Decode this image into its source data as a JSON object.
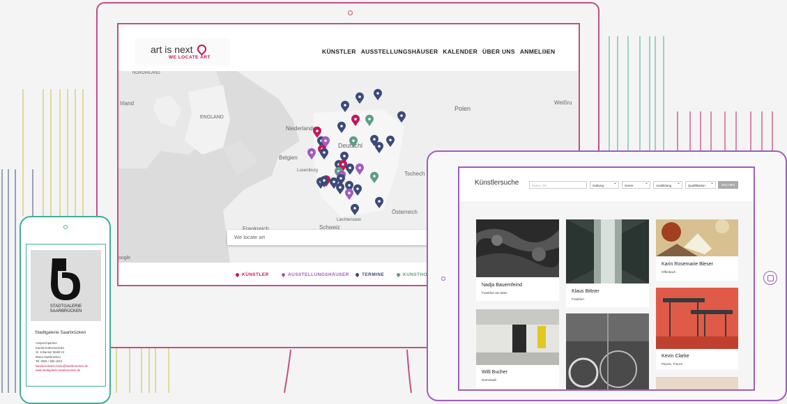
{
  "site": {
    "logo_text": "art is next",
    "logo_tagline": "WE LOCATE ART",
    "nav": [
      "KÜNSTLER",
      "AUSSTELLUNGSHÄUSER",
      "KALENDER",
      "ÜBER UNS",
      "ANMELDEN"
    ],
    "lang": "EN",
    "search_placeholder": "We locate art",
    "legend": [
      {
        "label": "KÜNSTLER",
        "color": "#c2185b"
      },
      {
        "label": "AUSSTELLUNGSHÄUSER",
        "color": "#a15bbf"
      },
      {
        "label": "TERMINE",
        "color": "#3b4a7a"
      },
      {
        "label": "KUNSTHO",
        "color": "#5c9e85"
      }
    ],
    "map_labels": [
      "NORDIRLAND",
      "Irland",
      "ENGLAND",
      "Niederlande",
      "Polen",
      "Weißru",
      "Deutschl",
      "Belgien",
      "Luxemburg",
      "Tschech",
      "Österreich",
      "Schweiz",
      "Liechtenstein",
      "Frankreich",
      "oogle"
    ]
  },
  "phone": {
    "logo_line1": "STADTGALERIE",
    "logo_line2": "SAARBRÜCKEN",
    "gallery_name": "Stadtgalerie Saarbrücken",
    "contact_lines": [
      "Ansprechpartner",
      "Kamila Kolesniczenko",
      "St. Johanner Markt 24",
      "66111 Saarbrücken",
      "Tel. 0681 / 905 1843"
    ],
    "email": "kamila.kolesniczenko@saarbruecken.de",
    "web": "www.stadtgalerie-saarbruecken.de"
  },
  "tablet": {
    "title": "Künstlersuche",
    "search_placeholder": "Name, Ort",
    "filters": [
      "Gattung",
      "Genre",
      "Ausbildung",
      "Qualifikation"
    ],
    "search_button": "SUCHEN",
    "artists": [
      {
        "name": "Nadja Bauernfeind",
        "place": "Frankfurt am Main"
      },
      {
        "name": "Klaus Bittner",
        "place": "Frankfurt"
      },
      {
        "name": "Karin Rosemarie Bleser",
        "place": "Offenbach"
      },
      {
        "name": "Willi Bucher",
        "place": "Darmstadt"
      },
      {
        "name": "Kevin Clarke",
        "place": "Payrac, France"
      }
    ]
  }
}
